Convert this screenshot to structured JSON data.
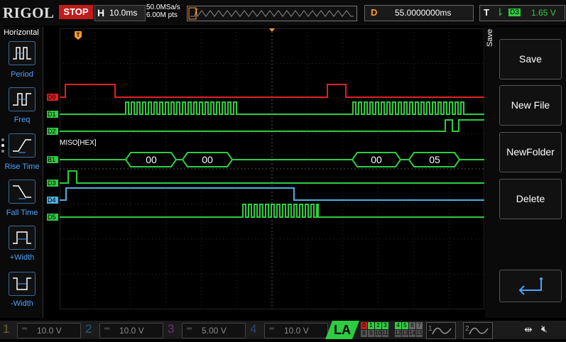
{
  "top": {
    "logo": "RIGOL",
    "run_state": "STOP",
    "horizontal_key": "H",
    "timebase": "10.0ms",
    "sample_rate": "50.0MSa/s",
    "memory_depth": "6.00M pts",
    "delay_key": "D",
    "delay_value": "55.0000000ms",
    "trigger_key": "T",
    "trigger_source": "D3",
    "trigger_level": "1.65 V"
  },
  "left_panel": {
    "title": "Horizontal",
    "items": [
      {
        "label": "Period",
        "icon": "period-icon"
      },
      {
        "label": "Freq",
        "icon": "freq-icon"
      },
      {
        "label": "Rise Time",
        "icon": "rise-time-icon"
      },
      {
        "label": "Fall Time",
        "icon": "fall-time-icon"
      },
      {
        "label": "+Width",
        "icon": "pos-width-icon"
      },
      {
        "label": "-Width",
        "icon": "neg-width-icon"
      }
    ]
  },
  "right_panel": {
    "title": "Save",
    "buttons": [
      "Save",
      "New File",
      "NewFolder",
      "Delete"
    ],
    "enter_icon": "enter-icon"
  },
  "screen": {
    "channels": [
      "D0",
      "D1",
      "D2",
      "B1",
      "D3",
      "D4",
      "D5"
    ],
    "bus_label": "MISO[HEX]",
    "bus_values": [
      "00",
      "00",
      "00",
      "05"
    ]
  },
  "bottom": {
    "channels": [
      {
        "num": "1",
        "scale": "10.0 V",
        "color": "#d6c23a"
      },
      {
        "num": "2",
        "scale": "10.0 V",
        "color": "#2a9bd6"
      },
      {
        "num": "3",
        "scale": "5.00 V",
        "color": "#c04bd6"
      },
      {
        "num": "4",
        "scale": "10.0 V",
        "color": "#3b6fd6"
      }
    ],
    "la_label": "LA",
    "la_row1": [
      "0",
      "1",
      "2",
      "3",
      "4",
      "5",
      "6",
      "7"
    ],
    "la_row2": [
      "8",
      "9",
      "10",
      "11",
      "12",
      "13",
      "14",
      "15"
    ],
    "wave1": "1",
    "wave2": "2"
  },
  "colors": {
    "accent_green": "#2ecc40",
    "stop_red": "#c21b1b",
    "d0_red": "#e02020",
    "d4_cyan": "#4fb0e0",
    "label_blue": "#4aa3ff",
    "delay_orange": "#ff9a2e"
  }
}
